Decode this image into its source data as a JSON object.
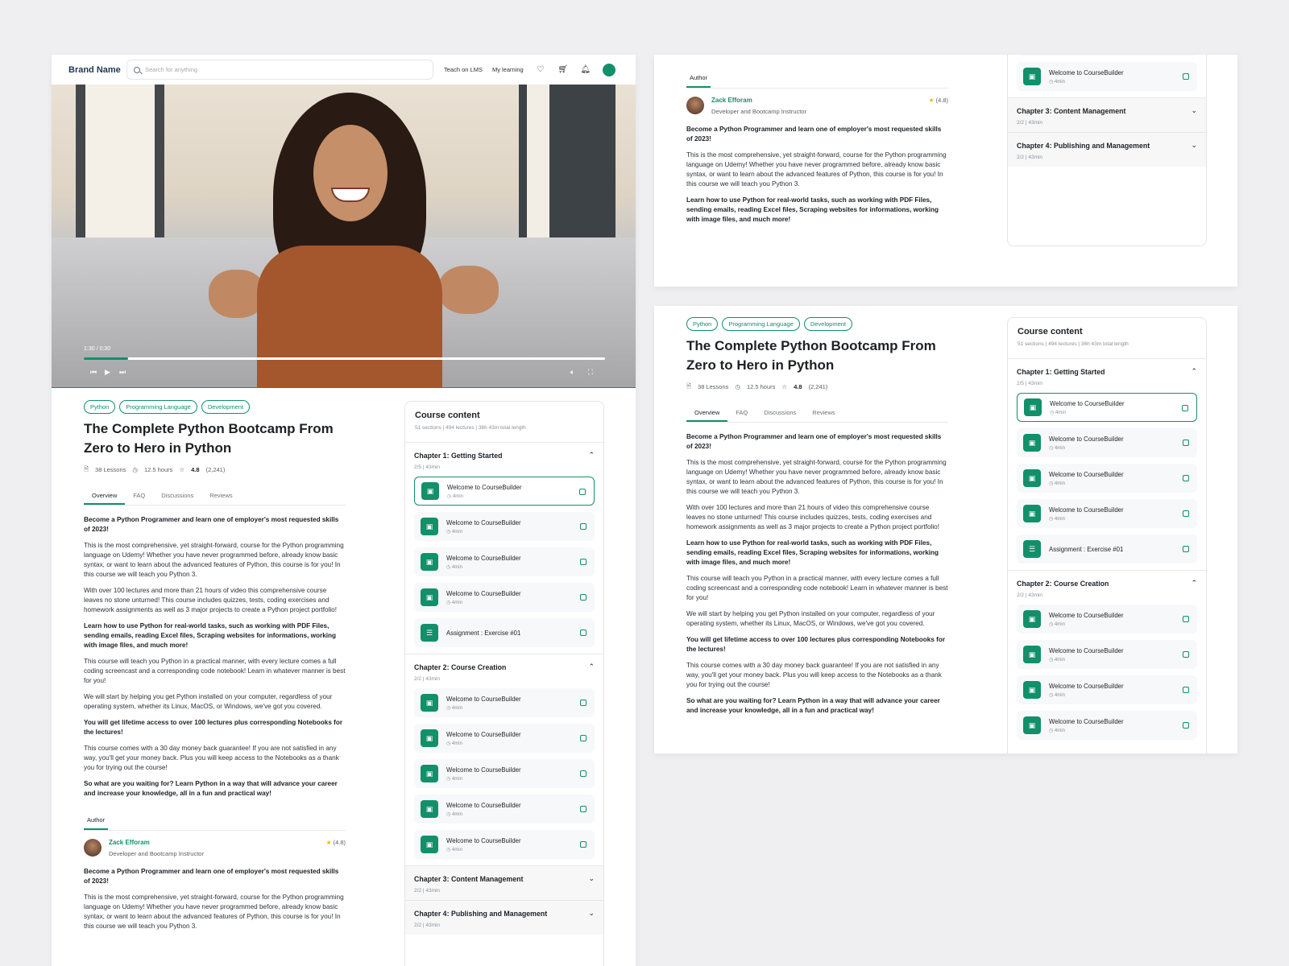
{
  "header": {
    "brand": "Brand Name",
    "search_placeholder": "Search for anything",
    "nav": [
      "Teach on LMS",
      "My learning"
    ]
  },
  "video": {
    "time": "1:30 / 0:30",
    "progress": 0.085
  },
  "course": {
    "tags": [
      "Python",
      "Programming Language",
      "Development"
    ],
    "title_line1": "The Complete Python Bootcamp From",
    "title_line2": "Zero to Hero in Python",
    "lessons": "38 Lessons",
    "hours": "12.5 hours",
    "rating": "4.8",
    "rating_count": "(2,241)",
    "tabs": [
      "Overview",
      "FAQ",
      "Discussions",
      "Reviews"
    ],
    "paragraphs": [
      {
        "bold": true,
        "text": "Become a Python Programmer and learn one of employer's most requested skills of 2023!"
      },
      {
        "bold": false,
        "text": "This is the most comprehensive, yet straight-forward, course for the Python programming language on Udemy! Whether you have never programmed before, already know basic syntax, or want to learn about the advanced features of Python, this course is for you! In this course we will teach you Python 3."
      },
      {
        "bold": false,
        "text": "With over 100 lectures and more than 21 hours of video this comprehensive course leaves no stone unturned! This course includes quizzes, tests, coding exercises and homework assignments as well as 3 major projects to create a Python project portfolio!"
      },
      {
        "bold": true,
        "text": "Learn how to use Python for real-world tasks, such as working with PDF Files, sending emails, reading Excel files, Scraping websites for informations, working with image files, and much more!"
      },
      {
        "bold": false,
        "text": "This course will teach you Python in a practical manner, with every lecture comes a full coding screencast and a corresponding code notebook! Learn in whatever manner is best for you!"
      },
      {
        "bold": false,
        "text": "We will start by helping you get Python installed on your computer, regardless of your operating system, whether its Linux, MacOS, or Windows, we've got you covered."
      },
      {
        "bold": true,
        "text": "You will get lifetime access to over 100 lectures plus corresponding Notebooks for the lectures!"
      },
      {
        "bold": false,
        "text": "This course comes with a 30 day money back guarantee! If you are not satisfied in any way, you'll get your money back. Plus you will keep access to the Notebooks as a thank you for trying out the course!"
      },
      {
        "bold": true,
        "text": "So what are you waiting for? Learn Python in a way that will advance your career and increase your knowledge, all in a fun and practical way!"
      }
    ]
  },
  "author": {
    "tab": "Author",
    "name": "Zack Efforam",
    "role": "Developer and Bootcamp Instructor",
    "rating": "(4.8)",
    "paragraphs": [
      {
        "bold": true,
        "text": "Become a Python Programmer and learn one of employer's most requested skills of 2023!"
      },
      {
        "bold": false,
        "text": "This is the most comprehensive, yet straight-forward, course for the Python programming language on Udemy! Whether you have never programmed before, already know basic syntax, or want to learn about the advanced features of Python, this course is for you! In this course we will teach you Python 3."
      },
      {
        "bold": true,
        "text": "Learn how to use Python for real-world tasks, such as working with PDF Files, sending emails, reading Excel files, Scraping websites for informations, working with image files, and much more!"
      }
    ]
  },
  "content": {
    "title": "Course content",
    "sub": "51 sections  |  494 lectures  |  36h 43m total length",
    "lesson_title": "Welcome to CourseBuilder",
    "lesson_min": "4min",
    "assignment": "Assignment : Exercise #01",
    "chapters": [
      {
        "title": "Chapter 1: Getting Started",
        "sub": "2/5  |  43min"
      },
      {
        "title": "Chapter 2: Course Creation",
        "sub": "2/2  |  43min"
      },
      {
        "title": "Chapter 3: Content Management",
        "sub": "2/2  |  43min"
      },
      {
        "title": "Chapter 4: Publishing and Management",
        "sub": "2/2  |  43min"
      }
    ]
  },
  "colors": {
    "accent": "#11906a"
  }
}
